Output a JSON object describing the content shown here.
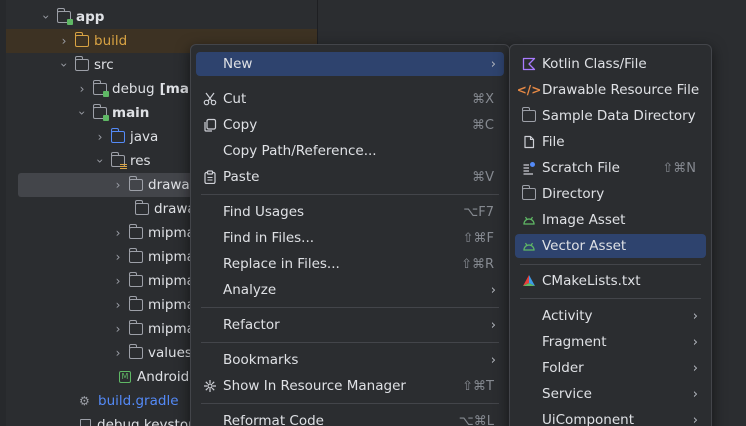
{
  "tree": {
    "app": "app",
    "build": "build",
    "src": "src",
    "debug": "debug",
    "debug_bracket": "[main]",
    "main": "main",
    "java": "java",
    "res": "res",
    "drawable1": "drawable",
    "drawable2": "drawable",
    "mipmap1": "mipmap",
    "mipmap2": "mipmap",
    "mipmap3": "mipmap",
    "mipmap4": "mipmap",
    "mipmap5": "mipmap",
    "values": "values",
    "manifest": "AndroidManifest.xml",
    "build_gradle": "build.gradle",
    "debug_keystore": "debug.keystore"
  },
  "context_menu": {
    "new": "New",
    "cut": "Cut",
    "cut_sc": "⌘X",
    "copy": "Copy",
    "copy_sc": "⌘C",
    "copy_path": "Copy Path/Reference...",
    "paste": "Paste",
    "paste_sc": "⌘V",
    "find_usages": "Find Usages",
    "find_usages_sc": "⌥F7",
    "find_in_files": "Find in Files...",
    "find_in_files_sc": "⇧⌘F",
    "replace_in_files": "Replace in Files...",
    "replace_in_files_sc": "⇧⌘R",
    "analyze": "Analyze",
    "refactor": "Refactor",
    "bookmarks": "Bookmarks",
    "show_in_resource_manager": "Show In Resource Manager",
    "show_in_resource_manager_sc": "⇧⌘T",
    "reformat_code": "Reformat Code",
    "reformat_code_sc": "⌥⌘L"
  },
  "new_submenu": {
    "kotlin": "Kotlin Class/File",
    "drawable": "Drawable Resource File",
    "sample_data": "Sample Data Directory",
    "file": "File",
    "scratch": "Scratch File",
    "scratch_sc": "⇧⌘N",
    "directory": "Directory",
    "image_asset": "Image Asset",
    "vector_asset": "Vector Asset",
    "cmake": "CMakeLists.txt",
    "activity": "Activity",
    "fragment": "Fragment",
    "folder": "Folder",
    "service": "Service",
    "uicomponent": "UiComponent"
  },
  "colors": {
    "highlight": "#2e436e",
    "selection": "#43454a",
    "accent_blue": "#548af7",
    "android_green": "#5fb865",
    "folder_orange": "#d9a343"
  }
}
